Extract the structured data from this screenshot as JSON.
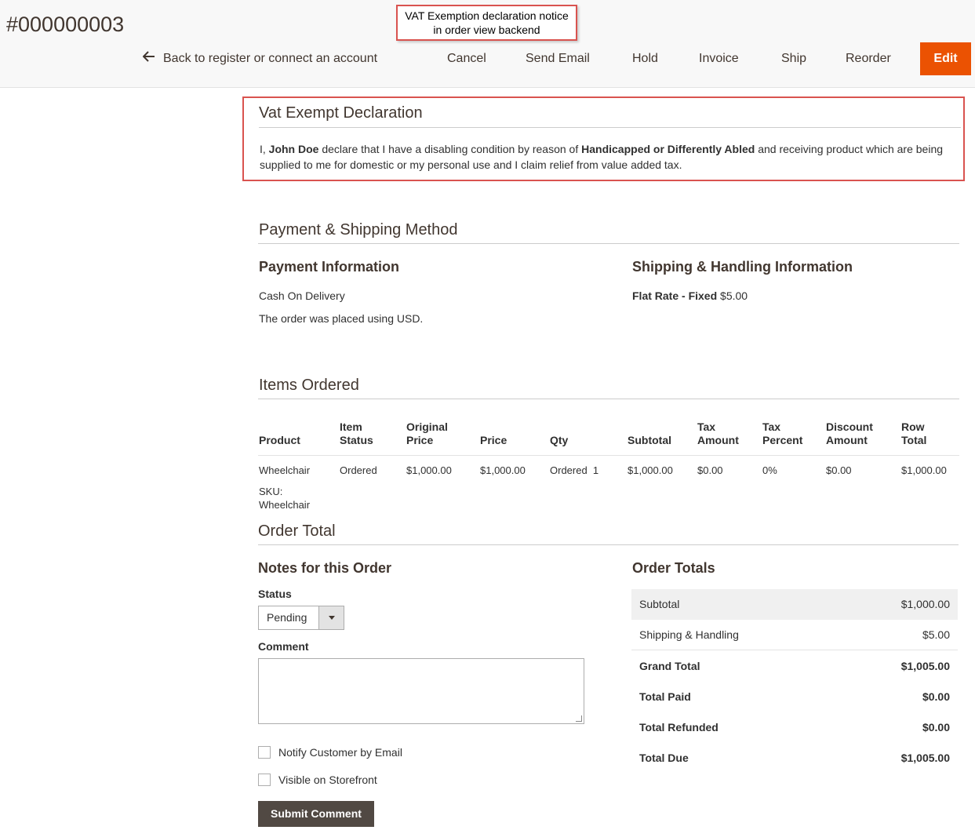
{
  "header": {
    "order_number": "#000000003",
    "callout_line1": "VAT Exemption declaration notice",
    "callout_line2": "in order view backend",
    "actions": {
      "back": "Back to register or connect an account",
      "cancel": "Cancel",
      "send_email": "Send Email",
      "hold": "Hold",
      "invoice": "Invoice",
      "ship": "Ship",
      "reorder": "Reorder",
      "edit": "Edit"
    },
    "edit_color": "#eb5202"
  },
  "vat": {
    "title": "Vat Exempt Declaration",
    "prefix": "I, ",
    "name": "John Doe",
    "middle": " declare that I have a disabling condition by reason of ",
    "reason": "Handicapped or Differently Abled",
    "suffix": " and receiving product which are being supplied to me for domestic or my personal use and I claim relief from value added tax."
  },
  "payment_shipping": {
    "title": "Payment & Shipping Method",
    "payment_title": "Payment Information",
    "payment_method": "Cash On Delivery",
    "currency_note": "The order was placed using USD.",
    "shipping_title": "Shipping & Handling Information",
    "shipping_method": "Flat Rate - Fixed",
    "shipping_price": "$5.00"
  },
  "items": {
    "title": "Items Ordered",
    "headers": {
      "product": "Product",
      "item_status_1": "Item",
      "item_status_2": "Status",
      "original_price_1": "Original",
      "original_price_2": "Price",
      "price": "Price",
      "qty": "Qty",
      "subtotal": "Subtotal",
      "tax_amount_1": "Tax",
      "tax_amount_2": "Amount",
      "tax_percent_1": "Tax",
      "tax_percent_2": "Percent",
      "discount_1": "Discount",
      "discount_2": "Amount",
      "row_total_1": "Row",
      "row_total_2": "Total"
    },
    "rows": [
      {
        "product": "Wheelchair",
        "sku_label": "SKU:",
        "sku": "Wheelchair",
        "status": "Ordered",
        "original_price": "$1,000.00",
        "price": "$1,000.00",
        "qty": "Ordered  1",
        "subtotal": "$1,000.00",
        "tax_amount": "$0.00",
        "tax_percent": "0%",
        "discount": "$0.00",
        "row_total": "$1,000.00"
      }
    ]
  },
  "order_total": {
    "title": "Order Total",
    "notes_title": "Notes for this Order",
    "status_label": "Status",
    "status_value": "Pending",
    "comment_label": "Comment",
    "notify_label": "Notify Customer by Email",
    "visible_label": "Visible on Storefront",
    "submit_label": "Submit Comment",
    "totals_title": "Order Totals",
    "totals": [
      {
        "label": "Subtotal",
        "value": "$1,000.00"
      },
      {
        "label": "Shipping & Handling",
        "value": "$5.00"
      },
      {
        "label": "Grand Total",
        "value": "$1,005.00"
      },
      {
        "label": "Total Paid",
        "value": "$0.00"
      },
      {
        "label": "Total Refunded",
        "value": "$0.00"
      },
      {
        "label": "Total Due",
        "value": "$1,005.00"
      }
    ]
  }
}
